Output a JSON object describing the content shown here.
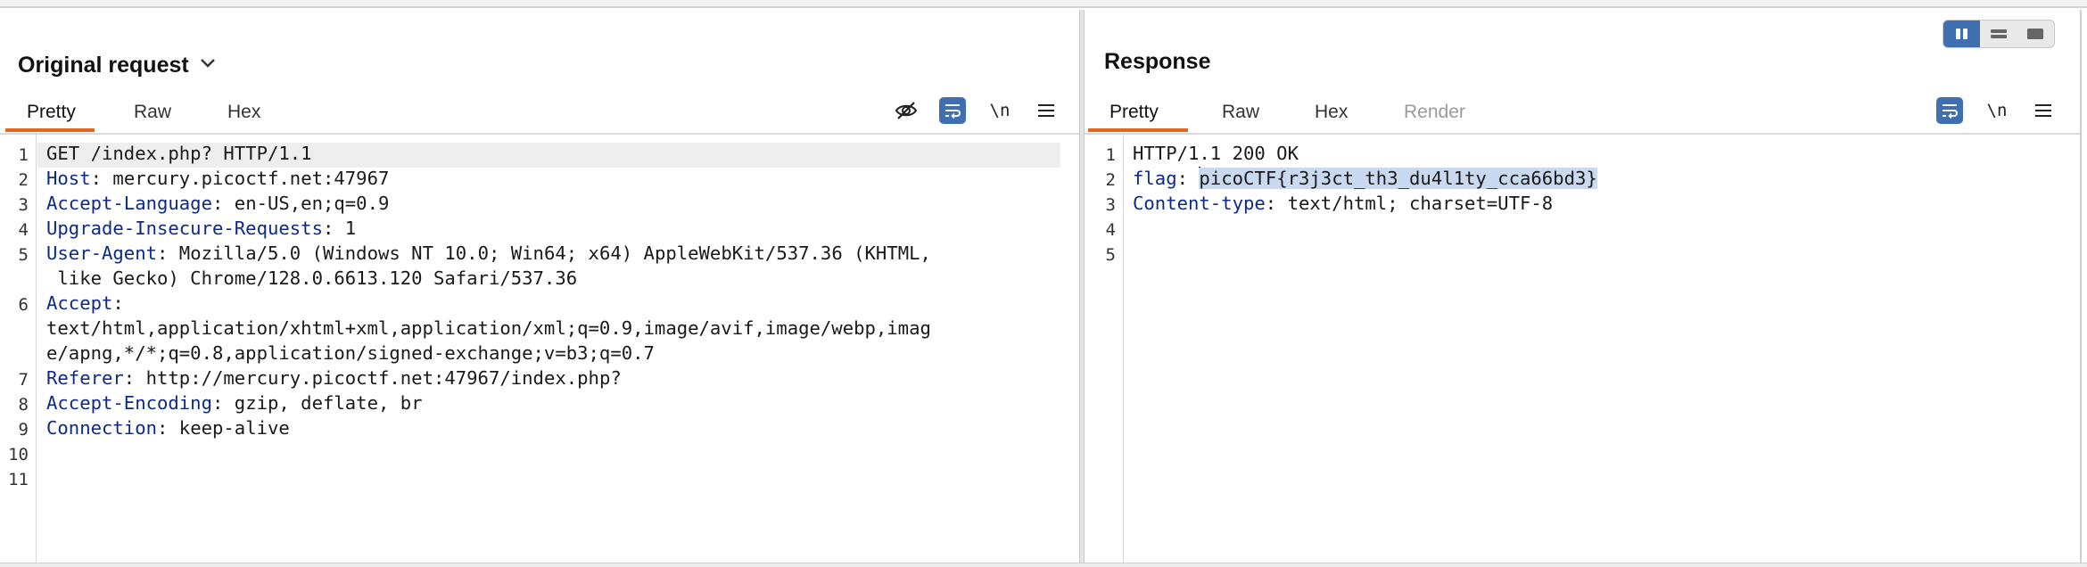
{
  "request": {
    "title": "Original request",
    "tabs": [
      "Pretty",
      "Raw",
      "Hex"
    ],
    "active_tab": "Pretty",
    "newline_label": "\\n",
    "line_numbers": [
      "1",
      "2",
      "3",
      "4",
      "5",
      "6",
      "7",
      "8",
      "9",
      "10",
      "11"
    ],
    "lines": {
      "l1": "GET /index.php? HTTP/1.1",
      "l2_key": "Host",
      "l2_val": " mercury.picoctf.net:47967",
      "l3_key": "Accept-Language",
      "l3_val": " en-US,en;q=0.9",
      "l4_key": "Upgrade-Insecure-Requests",
      "l4_val": " 1",
      "l5_key": "User-Agent",
      "l5_val": " Mozilla/5.0 (Windows NT 10.0; Win64; x64) AppleWebKit/537.36 (KHTML,",
      "l5_cont": " like Gecko) Chrome/128.0.6613.120 Safari/537.36",
      "l6_key": "Accept",
      "l6_cont1": "text/html,application/xhtml+xml,application/xml;q=0.9,image/avif,image/webp,imag",
      "l6_cont2": "e/apng,*/*;q=0.8,application/signed-exchange;v=b3;q=0.7",
      "l7_key": "Referer",
      "l7_val": " http://mercury.picoctf.net:47967/index.php?",
      "l8_key": "Accept-Encoding",
      "l8_val": " gzip, deflate, br",
      "l9_key": "Connection",
      "l9_val": " keep-alive"
    }
  },
  "response": {
    "title": "Response",
    "tabs": [
      "Pretty",
      "Raw",
      "Hex",
      "Render"
    ],
    "active_tab": "Pretty",
    "newline_label": "\\n",
    "line_numbers": [
      "1",
      "2",
      "3",
      "4",
      "5"
    ],
    "lines": {
      "l1": "HTTP/1.1 200 OK",
      "l2_key": "flag",
      "l2_val": "picoCTF{r3j3ct_th3_du4l1ty_cca66bd3}",
      "l3_key": "Content-type",
      "l3_val": " text/html; charset=UTF-8"
    }
  },
  "colors": {
    "accent_tab": "#e0671f",
    "toggle_on": "#3f6fb0",
    "header_key": "#0d2a86",
    "selection": "#c9d9ef"
  },
  "icons": [
    "chevron-down-icon",
    "eye-off-icon",
    "wrap-lines-icon",
    "newline-icon",
    "menu-icon",
    "layout-split-icon",
    "layout-rows-icon",
    "layout-single-icon"
  ]
}
